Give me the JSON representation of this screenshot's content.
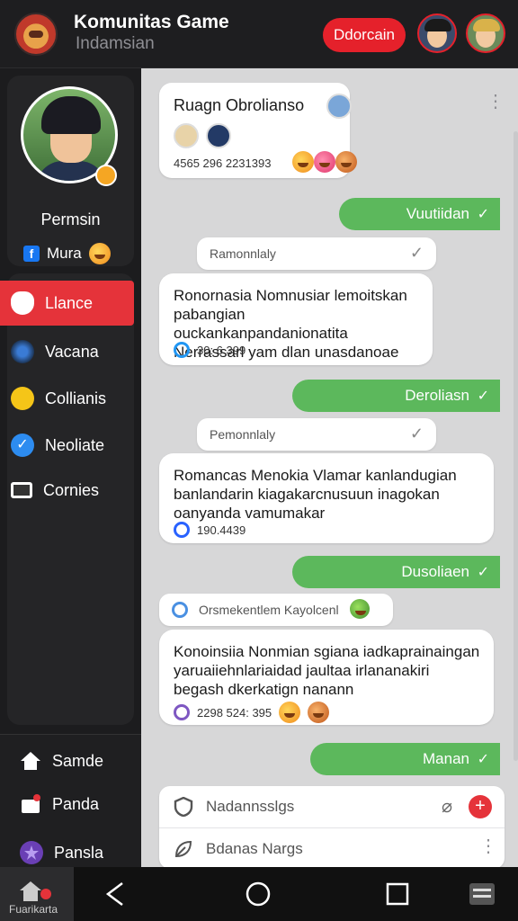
{
  "header": {
    "title": "Komunitas Game",
    "subtitle": "Indamsian",
    "action_label": "Ddorcain",
    "colors": {
      "accent": "#e5212b",
      "background": "#1e1e20"
    }
  },
  "profile": {
    "name": "Permsin",
    "social_label": "Mura"
  },
  "nav": {
    "items": [
      {
        "label": "Llance",
        "icon": "apple-icon",
        "active": true
      },
      {
        "label": "Vacana",
        "icon": "game-world-icon",
        "active": false
      },
      {
        "label": "Collianis",
        "icon": "lightning-icon",
        "active": false
      },
      {
        "label": "Neoliate",
        "icon": "checkmark-icon",
        "active": false
      },
      {
        "label": "Cornies",
        "icon": "screen-icon",
        "active": false
      }
    ],
    "bottom": [
      {
        "label": "Samde",
        "icon": "home-icon"
      },
      {
        "label": "Panda",
        "icon": "bag-icon"
      },
      {
        "label": "Pansla",
        "icon": "star-icon"
      }
    ]
  },
  "chat": {
    "room": {
      "title": "Ruagn Obrolianso",
      "info": "4565 296 2231393"
    },
    "messages": [
      {
        "type": "out",
        "text": "Vuutiidan"
      },
      {
        "type": "reply",
        "text": "Ramonnlaly"
      },
      {
        "type": "in",
        "text": "Ronornasia Nomnusiar lemoitskan pabangian ouckankanpandanionatita Nerrassarl yam dlan unasdanoae",
        "meta": "30: 6 399"
      },
      {
        "type": "out",
        "text": "Deroliasn"
      },
      {
        "type": "reply",
        "text": "Pemonnlaly"
      },
      {
        "type": "in",
        "text": "Romancas Menokia Vlamar kanlandugian banlandarin kiagakarcnusuun inagokan oanyanda vamumakar",
        "meta": "190.4439"
      },
      {
        "type": "out",
        "text": "Dusoliaen"
      },
      {
        "type": "reply",
        "text": "Orsmekentlem Kayolcenl"
      },
      {
        "type": "in",
        "text": "Konoinsiia Nonmian sgiana iadkaprainaingan yaruaiiehnlariaidad jaultaa irlananakiri begash dkerkatign nanann",
        "meta": "2298 524: 395"
      },
      {
        "type": "out",
        "text": "Manan"
      }
    ],
    "composer": {
      "input_placeholder": "Nadannsslgs",
      "secondary_placeholder": "Bdanas Nargs"
    }
  },
  "system_nav": {
    "home_label": "Fuarikarta"
  }
}
